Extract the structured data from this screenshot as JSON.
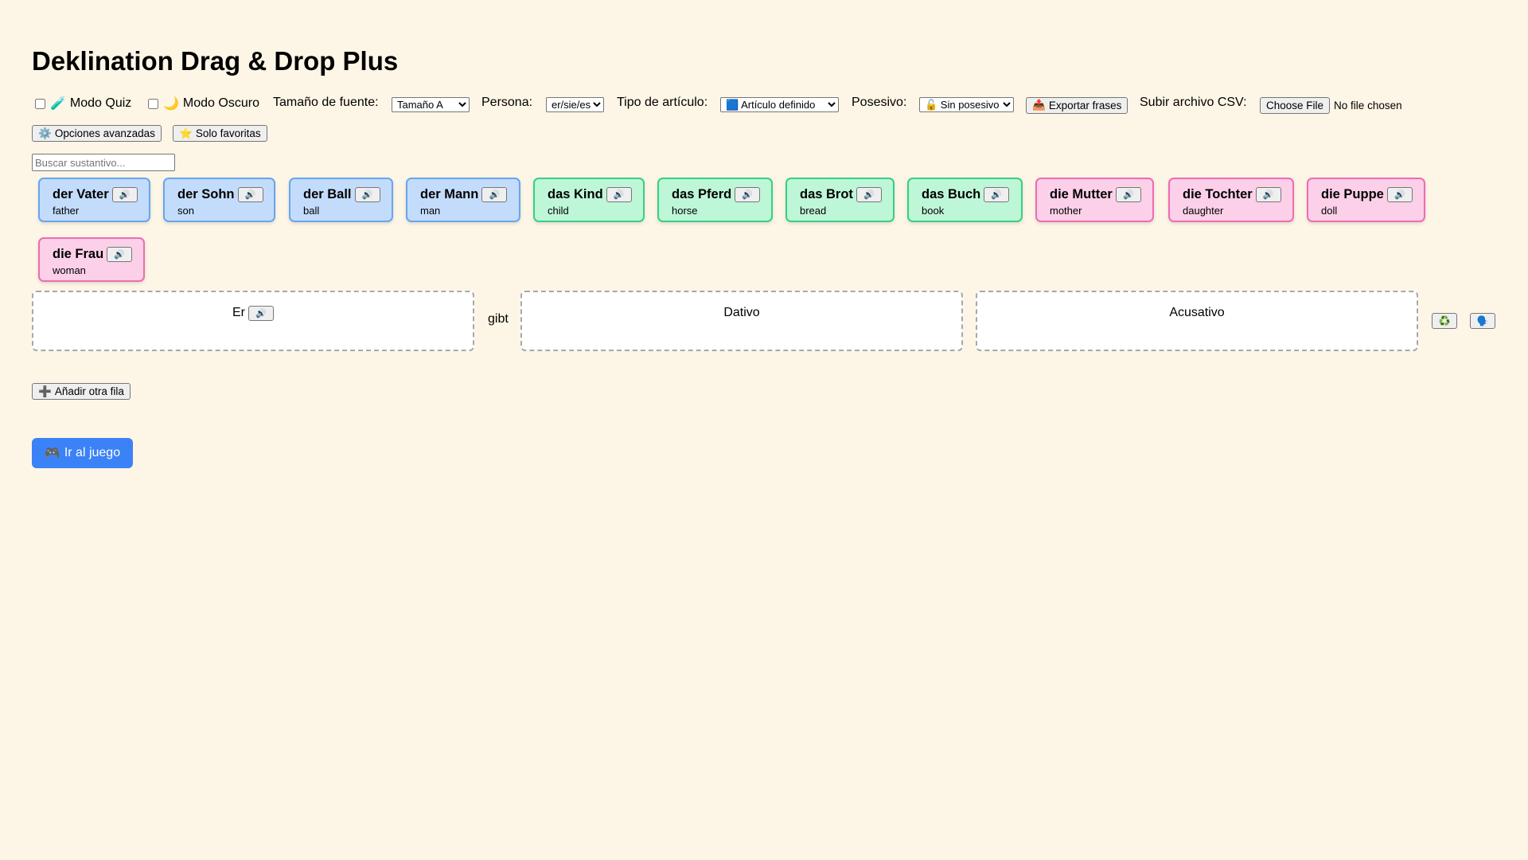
{
  "title": "Deklination Drag & Drop Plus",
  "toolbar": {
    "quiz_icon": "🧪",
    "quiz_label": "Modo Quiz",
    "dark_icon": "🌙",
    "dark_label": "Modo Oscuro",
    "font_size_label": "Tamaño de fuente:",
    "font_size_value": "Tamaño A",
    "persona_label": "Persona:",
    "persona_value": "er/sie/es",
    "article_label": "Tipo de artículo:",
    "article_value": "🟦 Artículo definido",
    "possessive_label": "Posesivo:",
    "possessive_value": "🔓 Sin posesivo",
    "export_icon": "📤",
    "export_label": "Exportar frases",
    "csv_label": "Subir archivo CSV:",
    "csv_button": "Choose File",
    "csv_status": "No file chosen"
  },
  "row2": {
    "advanced_icon": "⚙️",
    "advanced_label": "Opciones avanzadas",
    "favorites_icon": "⭐",
    "favorites_label": "Solo favoritas"
  },
  "search": {
    "placeholder": "Buscar sustantivo..."
  },
  "speaker_icon": "🔊",
  "nouns": [
    {
      "word": "der Vater",
      "translation": "father",
      "gender": "m"
    },
    {
      "word": "der Sohn",
      "translation": "son",
      "gender": "m"
    },
    {
      "word": "der Ball",
      "translation": "ball",
      "gender": "m"
    },
    {
      "word": "der Mann",
      "translation": "man",
      "gender": "m"
    },
    {
      "word": "das Kind",
      "translation": "child",
      "gender": "n"
    },
    {
      "word": "das Pferd",
      "translation": "horse",
      "gender": "n"
    },
    {
      "word": "das Brot",
      "translation": "bread",
      "gender": "n"
    },
    {
      "word": "das Buch",
      "translation": "book",
      "gender": "n"
    },
    {
      "word": "die Mutter",
      "translation": "mother",
      "gender": "f"
    },
    {
      "word": "die Tochter",
      "translation": "daughter",
      "gender": "f"
    },
    {
      "word": "die Puppe",
      "translation": "doll",
      "gender": "f"
    },
    {
      "word": "die Frau",
      "translation": "woman",
      "gender": "f"
    }
  ],
  "sentence": {
    "subject": "Er",
    "verb": "gibt",
    "dative_label": "Dativo",
    "accusative_label": "Acusativo",
    "reset_icon": "♻️",
    "speak_icon": "🗣️"
  },
  "add_row": {
    "icon": "➕",
    "label": "Añadir otra fila"
  },
  "go_game": {
    "icon": "🎮",
    "label": "Ir al juego"
  },
  "colors": {
    "background": "#fdf6e6",
    "masculine_bg": "#c4dcfc",
    "masculine_border": "#66a6f0",
    "neuter_bg": "#bef6d8",
    "neuter_border": "#38cf84",
    "feminine_bg": "#fbd0e8",
    "feminine_border": "#ee6cb2",
    "primary_button": "#3b82f6"
  }
}
